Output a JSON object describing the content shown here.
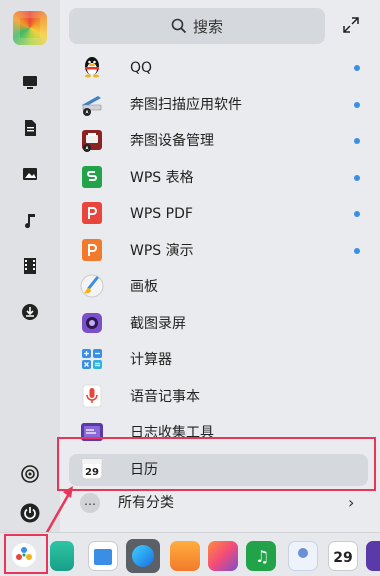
{
  "search": {
    "label": "搜索"
  },
  "apps": [
    {
      "name": "QQ",
      "dot": true
    },
    {
      "name": "奔图扫描应用软件",
      "dot": true
    },
    {
      "name": "奔图设备管理",
      "dot": true
    },
    {
      "name": "WPS 表格",
      "dot": true
    },
    {
      "name": "WPS PDF",
      "dot": true
    },
    {
      "name": "WPS 演示",
      "dot": true
    },
    {
      "name": "画板",
      "dot": false
    },
    {
      "name": "截图录屏",
      "dot": false
    },
    {
      "name": "计算器",
      "dot": false
    },
    {
      "name": "语音记事本",
      "dot": false
    },
    {
      "name": "日志收集工具",
      "dot": false
    },
    {
      "name": "日历",
      "dot": false,
      "selected": true,
      "calendar_day": "29"
    }
  ],
  "all_categories": {
    "label": "所有分类",
    "more_glyph": "…",
    "chevron": "›"
  },
  "taskbar": {
    "calendar_day": "29"
  },
  "colors": {
    "highlight": "#e8365a",
    "badge_dot": "#3a8ee6"
  }
}
